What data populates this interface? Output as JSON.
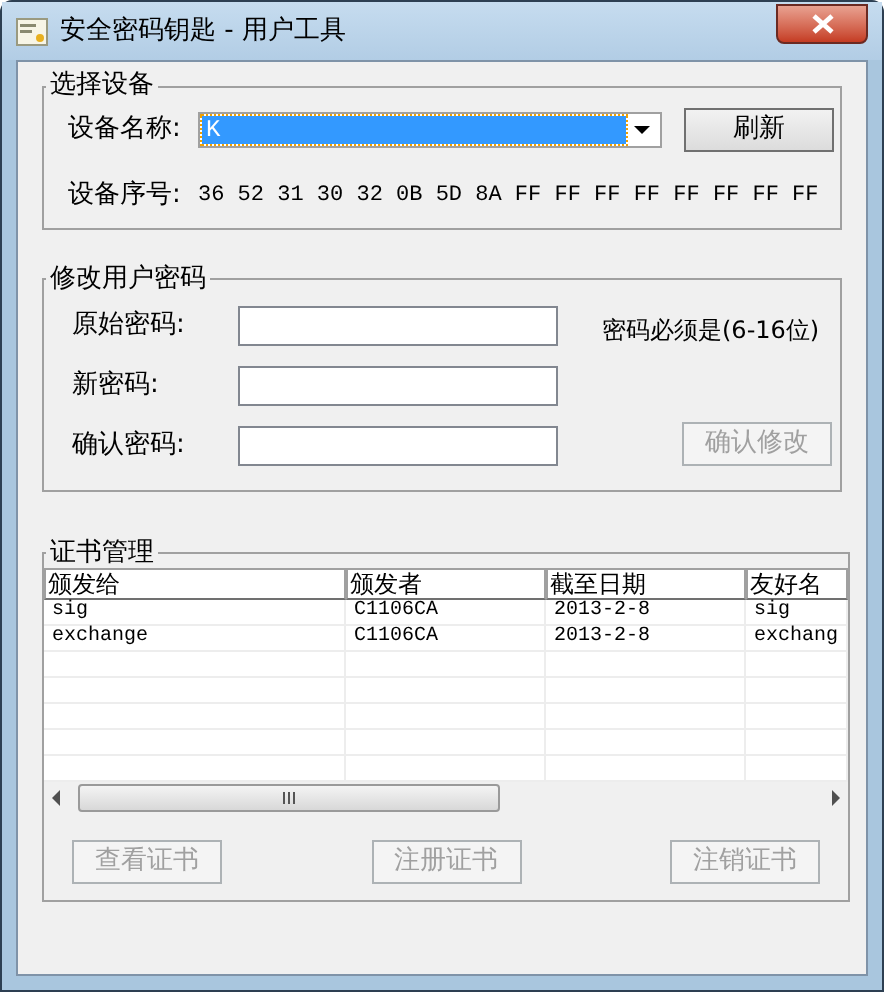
{
  "window": {
    "title": "安全密码钥匙 - 用户工具"
  },
  "device_group": {
    "title": "选择设备",
    "name_label": "设备名称:",
    "device_value": "K",
    "device_focused": true,
    "refresh_button": {
      "label": "刷新",
      "disabled": false
    },
    "serial_label": "设备序号:",
    "serial_value": "36 52 31 30 32 0B 5D 8A FF FF FF FF FF FF FF FF"
  },
  "password_group": {
    "title": "修改用户密码",
    "fields": [
      {
        "label": "原始密码:"
      },
      {
        "label": "新密码:"
      },
      {
        "label": "确认密码:"
      }
    ],
    "hint": "密码必须是(6-16位)",
    "confirm_button": {
      "label": "确认修改",
      "disabled": true
    }
  },
  "cert_group": {
    "title": "证书管理",
    "table": {
      "columns": [
        "颁发给",
        "颁发者",
        "截至日期",
        "友好名"
      ],
      "rows": [
        [
          "sig",
          "C1106CA",
          "2013-2-8",
          "sig"
        ],
        [
          "exchange",
          "C1106CA",
          "2013-2-8",
          "exchang"
        ]
      ]
    },
    "buttons": [
      {
        "label": "查看证书",
        "disabled": true
      },
      {
        "label": "注册证书",
        "disabled": true
      },
      {
        "label": "注销证书",
        "disabled": true
      }
    ]
  }
}
